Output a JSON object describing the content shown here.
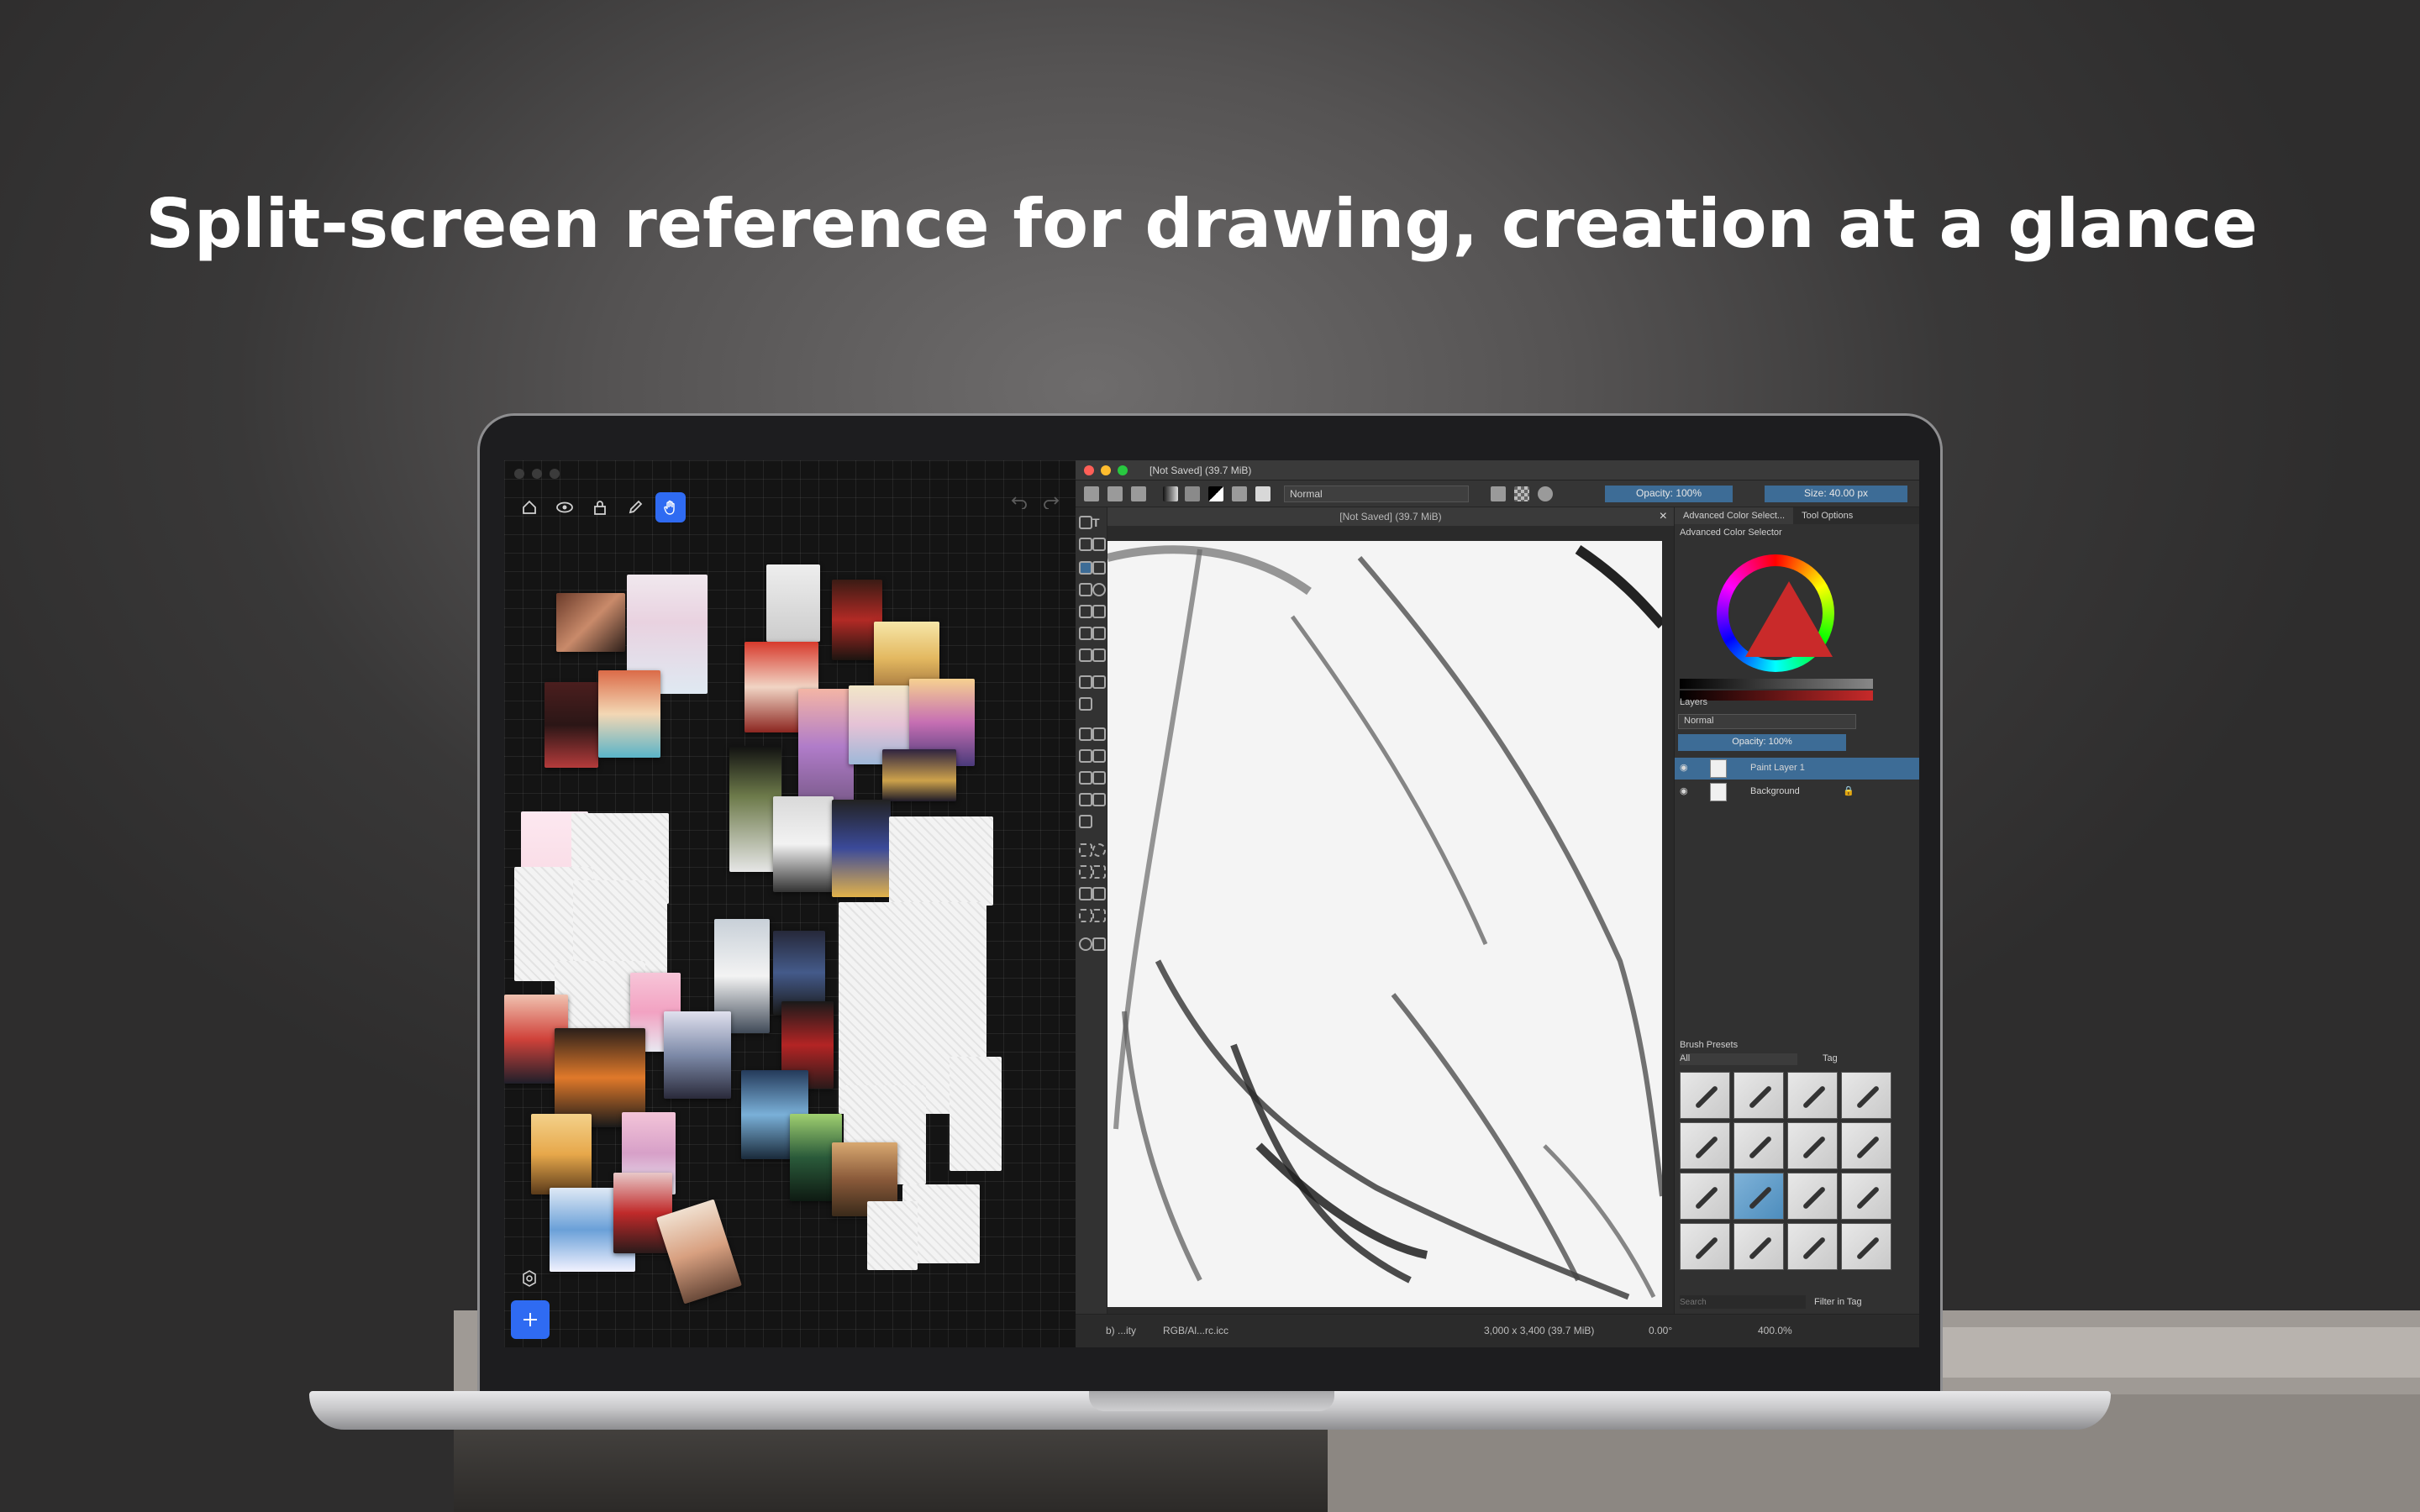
{
  "headline": "Split-screen reference for drawing, creation at a glance",
  "left_app": {
    "toolbar": [
      {
        "name": "home-icon",
        "glyph": "⌂"
      },
      {
        "name": "eye-icon",
        "glyph": "◉"
      },
      {
        "name": "lock-icon",
        "glyph": "🔒"
      },
      {
        "name": "pencil-icon",
        "glyph": "✎"
      },
      {
        "name": "hand-icon",
        "glyph": "✋"
      }
    ],
    "undo_glyph": "↶",
    "redo_glyph": "↷",
    "settings_glyph": "⚙",
    "add_glyph": "+",
    "accent": "#2f6bf2"
  },
  "krita": {
    "window_title": "[Not Saved]  (39.7 MiB)",
    "blend_mode": "Normal",
    "opacity": "Opacity: 100%",
    "size": "Size: 40.00 px",
    "doc_tab": "[Not Saved]  (39.7 MiB)",
    "docker_tabs": [
      "Advanced Color Select...",
      "Tool Options"
    ],
    "color_selector_title": "Advanced Color Selector",
    "layers_title": "Layers",
    "layers_mode": "Normal",
    "layers_opacity": "Opacity:  100%",
    "layers": [
      {
        "name": "Paint Layer 1",
        "selected": true
      },
      {
        "name": "Background",
        "selected": false
      }
    ],
    "brush_presets_title": "Brush Presets",
    "brush_filter": "All",
    "brush_tag": "Tag",
    "brush_search_placeholder": "Search",
    "filter_in_tag": "Filter in Tag",
    "status": {
      "brush": "b) ...ity",
      "color_profile": "RGB/Al...rc.icc",
      "dimensions": "3,000 x 3,400 (39.7 MiB)",
      "rotation": "0.00°",
      "zoom": "400.0%"
    },
    "accent": "#3d6c96"
  }
}
